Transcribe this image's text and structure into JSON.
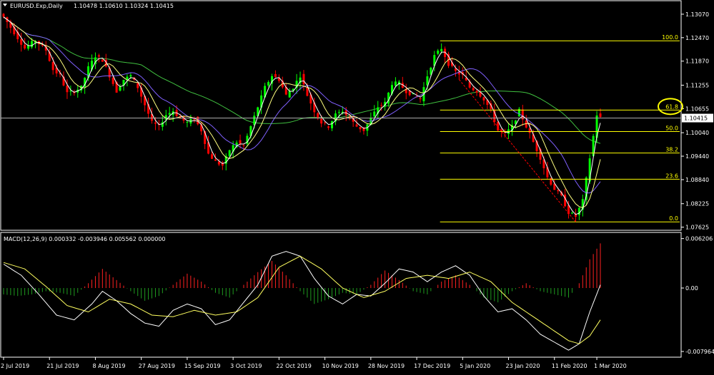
{
  "chart_data": [
    {
      "type": "candlestick",
      "symbol": "EURUSD.Exp,Daily",
      "ohlc_header": "1.10478 1.10610 1.10324 1.10415",
      "current_price": 1.10415,
      "current_price_label": "1.10415",
      "ylim": [
        1.076,
        1.1336
      ],
      "y_ticks": [
        {
          "value": 1.1307,
          "label": "1.13070"
        },
        {
          "value": 1.1247,
          "label": "1.12470"
        },
        {
          "value": 1.1187,
          "label": "1.11870"
        },
        {
          "value": 1.11255,
          "label": "1.11255"
        },
        {
          "value": 1.10655,
          "label": "1.10655"
        },
        {
          "value": 1.1004,
          "label": "1.10040"
        },
        {
          "value": 1.0944,
          "label": "1.09440"
        },
        {
          "value": 1.0884,
          "label": "1.08840"
        },
        {
          "value": 1.08225,
          "label": "1.08225"
        },
        {
          "value": 1.07625,
          "label": "1.07625"
        }
      ],
      "x_ticks": [
        {
          "index": 0,
          "label": "2 Jul 2019"
        },
        {
          "index": 13,
          "label": "21 Jul 2019"
        },
        {
          "index": 26,
          "label": "8 Aug 2019"
        },
        {
          "index": 39,
          "label": "27 Aug 2019"
        },
        {
          "index": 52,
          "label": "15 Sep 2019"
        },
        {
          "index": 65,
          "label": "3 Oct 2019"
        },
        {
          "index": 78,
          "label": "22 Oct 2019"
        },
        {
          "index": 91,
          "label": "10 Nov 2019"
        },
        {
          "index": 104,
          "label": "28 Nov 2019"
        },
        {
          "index": 117,
          "label": "17 Dec 2019"
        },
        {
          "index": 130,
          "label": "5 Jan 2020"
        },
        {
          "index": 143,
          "label": "23 Jan 2020"
        },
        {
          "index": 156,
          "label": "11 Feb 2020"
        },
        {
          "index": 168,
          "label": "1 Mar 2020"
        }
      ],
      "candle_count": 170,
      "close_anchors": [
        [
          0,
          1.13
        ],
        [
          3,
          1.126
        ],
        [
          6,
          1.122
        ],
        [
          9,
          1.124
        ],
        [
          12,
          1.1215
        ],
        [
          14,
          1.1165
        ],
        [
          16,
          1.115
        ],
        [
          18,
          1.1105
        ],
        [
          20,
          1.111
        ],
        [
          22,
          1.112
        ],
        [
          24,
          1.117
        ],
        [
          26,
          1.12
        ],
        [
          28,
          1.119
        ],
        [
          30,
          1.115
        ],
        [
          32,
          1.111
        ],
        [
          34,
          1.114
        ],
        [
          36,
          1.115
        ],
        [
          38,
          1.112
        ],
        [
          40,
          1.1075
        ],
        [
          42,
          1.103
        ],
        [
          44,
          1.102
        ],
        [
          46,
          1.105
        ],
        [
          48,
          1.106
        ],
        [
          50,
          1.104
        ],
        [
          52,
          1.103
        ],
        [
          54,
          1.104
        ],
        [
          56,
          1.101
        ],
        [
          58,
          1.095
        ],
        [
          60,
          1.093
        ],
        [
          62,
          1.092
        ],
        [
          64,
          1.096
        ],
        [
          66,
          1.098
        ],
        [
          68,
          1.097
        ],
        [
          70,
          1.102
        ],
        [
          72,
          1.107
        ],
        [
          74,
          1.112
        ],
        [
          76,
          1.115
        ],
        [
          78,
          1.114
        ],
        [
          80,
          1.11
        ],
        [
          82,
          1.112
        ],
        [
          84,
          1.115
        ],
        [
          86,
          1.11
        ],
        [
          88,
          1.106
        ],
        [
          90,
          1.103
        ],
        [
          92,
          1.102
        ],
        [
          94,
          1.105
        ],
        [
          96,
          1.106
        ],
        [
          98,
          1.104
        ],
        [
          100,
          1.102
        ],
        [
          102,
          1.101
        ],
        [
          104,
          1.104
        ],
        [
          106,
          1.107
        ],
        [
          108,
          1.108
        ],
        [
          110,
          1.113
        ],
        [
          112,
          1.113
        ],
        [
          114,
          1.111
        ],
        [
          116,
          1.11
        ],
        [
          118,
          1.109
        ],
        [
          120,
          1.115
        ],
        [
          122,
          1.12
        ],
        [
          124,
          1.122
        ],
        [
          126,
          1.118
        ],
        [
          128,
          1.116
        ],
        [
          130,
          1.115
        ],
        [
          132,
          1.112
        ],
        [
          134,
          1.111
        ],
        [
          136,
          1.109
        ],
        [
          138,
          1.106
        ],
        [
          140,
          1.101
        ],
        [
          142,
          1.1
        ],
        [
          144,
          1.102
        ],
        [
          146,
          1.106
        ],
        [
          148,
          1.102
        ],
        [
          150,
          1.098
        ],
        [
          152,
          1.094
        ],
        [
          154,
          1.089
        ],
        [
          156,
          1.086
        ],
        [
          158,
          1.084
        ],
        [
          160,
          1.08
        ],
        [
          162,
          1.079
        ],
        [
          164,
          1.083
        ],
        [
          166,
          1.094
        ],
        [
          168,
          1.105
        ],
        [
          169,
          1.1042
        ]
      ],
      "fibonacci": {
        "levels": [
          {
            "label": "100.0",
            "value": 1.1239
          },
          {
            "label": "61.8",
            "value": 1.1062
          },
          {
            "label": "50.0",
            "value": 1.1007
          },
          {
            "label": "38.2",
            "value": 1.0952
          },
          {
            "label": "23.6",
            "value": 1.0885
          },
          {
            "label": "0.0",
            "value": 1.0776
          }
        ],
        "start_index": 124,
        "end_index": 169,
        "trend_from": {
          "index": 129,
          "value": 1.114
        },
        "trend_to": {
          "index": 162,
          "value": 1.0776
        },
        "highlighted_level": "61.8"
      },
      "colors": {
        "background": "#000000",
        "axis": "#ffffff",
        "bull_candle": "#00ff00",
        "bear_candle": "#ff0000",
        "ma_fast": "#ffffff",
        "ma_mid": "#ffff80",
        "ma_slow_purple": "#8060ff",
        "ma_long": "#40c040",
        "fib_line": "#ffff00",
        "fib_trend": "#ff0000",
        "highlight_circle": "#ffff00",
        "current_price_line": "#b0b0b0"
      }
    },
    {
      "type": "macd",
      "label": "MACD(12,26,9) 0.000332 -0.003946 0.005562 0.000000",
      "ylim": [
        -0.0085,
        0.0068
      ],
      "y_ticks": [
        {
          "value": 0.006206,
          "label": "0.006206"
        },
        {
          "value": 0.0,
          "label": "0.00"
        },
        {
          "value": -0.007964,
          "label": "-0.007964"
        }
      ],
      "histogram_anchors": [
        [
          0,
          -0.0008
        ],
        [
          4,
          -0.001
        ],
        [
          8,
          -0.0008
        ],
        [
          12,
          -0.0004
        ],
        [
          16,
          -0.0006
        ],
        [
          20,
          -0.001
        ],
        [
          24,
          0.0006
        ],
        [
          28,
          0.0024
        ],
        [
          32,
          0.001
        ],
        [
          36,
          -0.0004
        ],
        [
          40,
          -0.0016
        ],
        [
          44,
          -0.001
        ],
        [
          48,
          0.0004
        ],
        [
          52,
          0.0018
        ],
        [
          56,
          0.0008
        ],
        [
          60,
          -0.0006
        ],
        [
          64,
          -0.0012
        ],
        [
          68,
          0.0004
        ],
        [
          72,
          0.002
        ],
        [
          76,
          0.0034
        ],
        [
          80,
          0.0016
        ],
        [
          84,
          -0.0004
        ],
        [
          88,
          -0.002
        ],
        [
          92,
          -0.0014
        ],
        [
          96,
          -0.0006
        ],
        [
          100,
          -0.0008
        ],
        [
          104,
          0.0004
        ],
        [
          108,
          0.0022
        ],
        [
          112,
          0.001
        ],
        [
          116,
          -0.0004
        ],
        [
          120,
          -0.0008
        ],
        [
          124,
          0.0008
        ],
        [
          128,
          0.0016
        ],
        [
          132,
          0.0004
        ],
        [
          136,
          -0.0012
        ],
        [
          140,
          -0.0018
        ],
        [
          144,
          -0.0004
        ],
        [
          148,
          0.0006
        ],
        [
          152,
          -0.0004
        ],
        [
          156,
          -0.0008
        ],
        [
          160,
          -0.0012
        ],
        [
          163,
          0.0006
        ],
        [
          166,
          0.0036
        ],
        [
          169,
          0.0056
        ]
      ],
      "macd_anchors": [
        [
          0,
          0.003
        ],
        [
          5,
          0.0016
        ],
        [
          10,
          -0.0008
        ],
        [
          15,
          -0.0034
        ],
        [
          20,
          -0.004
        ],
        [
          25,
          -0.002
        ],
        [
          28,
          -0.0004
        ],
        [
          32,
          -0.0016
        ],
        [
          36,
          -0.0032
        ],
        [
          40,
          -0.0044
        ],
        [
          44,
          -0.0048
        ],
        [
          48,
          -0.0028
        ],
        [
          52,
          -0.002
        ],
        [
          56,
          -0.0026
        ],
        [
          60,
          -0.0046
        ],
        [
          64,
          -0.004
        ],
        [
          68,
          -0.0018
        ],
        [
          72,
          0.0004
        ],
        [
          76,
          0.004
        ],
        [
          80,
          0.0046
        ],
        [
          84,
          0.004
        ],
        [
          88,
          0.0012
        ],
        [
          92,
          -0.001
        ],
        [
          96,
          -0.002
        ],
        [
          100,
          -0.0008
        ],
        [
          104,
          -0.001
        ],
        [
          108,
          0.0006
        ],
        [
          112,
          0.0024
        ],
        [
          116,
          0.002
        ],
        [
          120,
          0.0008
        ],
        [
          124,
          0.002
        ],
        [
          128,
          0.0028
        ],
        [
          132,
          0.0016
        ],
        [
          136,
          -0.001
        ],
        [
          140,
          -0.003
        ],
        [
          144,
          -0.0026
        ],
        [
          148,
          -0.004
        ],
        [
          152,
          -0.0058
        ],
        [
          156,
          -0.0068
        ],
        [
          160,
          -0.0078
        ],
        [
          163,
          -0.007
        ],
        [
          166,
          -0.003
        ],
        [
          169,
          0.0004
        ]
      ],
      "signal_anchors": [
        [
          0,
          0.0032
        ],
        [
          6,
          0.0024
        ],
        [
          12,
          0.0002
        ],
        [
          18,
          -0.0022
        ],
        [
          24,
          -0.003
        ],
        [
          30,
          -0.0014
        ],
        [
          36,
          -0.002
        ],
        [
          42,
          -0.0034
        ],
        [
          48,
          -0.0036
        ],
        [
          54,
          -0.0028
        ],
        [
          60,
          -0.0034
        ],
        [
          66,
          -0.003
        ],
        [
          72,
          -0.0012
        ],
        [
          78,
          0.0026
        ],
        [
          84,
          0.004
        ],
        [
          90,
          0.0024
        ],
        [
          96,
          0.0
        ],
        [
          102,
          -0.0012
        ],
        [
          108,
          -0.0004
        ],
        [
          114,
          0.0012
        ],
        [
          120,
          0.0016
        ],
        [
          126,
          0.0012
        ],
        [
          132,
          0.002
        ],
        [
          138,
          0.0008
        ],
        [
          144,
          -0.0018
        ],
        [
          150,
          -0.0036
        ],
        [
          156,
          -0.0054
        ],
        [
          160,
          -0.0066
        ],
        [
          163,
          -0.007
        ],
        [
          166,
          -0.006
        ],
        [
          169,
          -0.004
        ]
      ],
      "colors": {
        "hist_up": "#ff2020",
        "hist_down": "#1f9b1f",
        "macd_line": "#ffffff",
        "signal_line": "#ffff60"
      }
    }
  ]
}
